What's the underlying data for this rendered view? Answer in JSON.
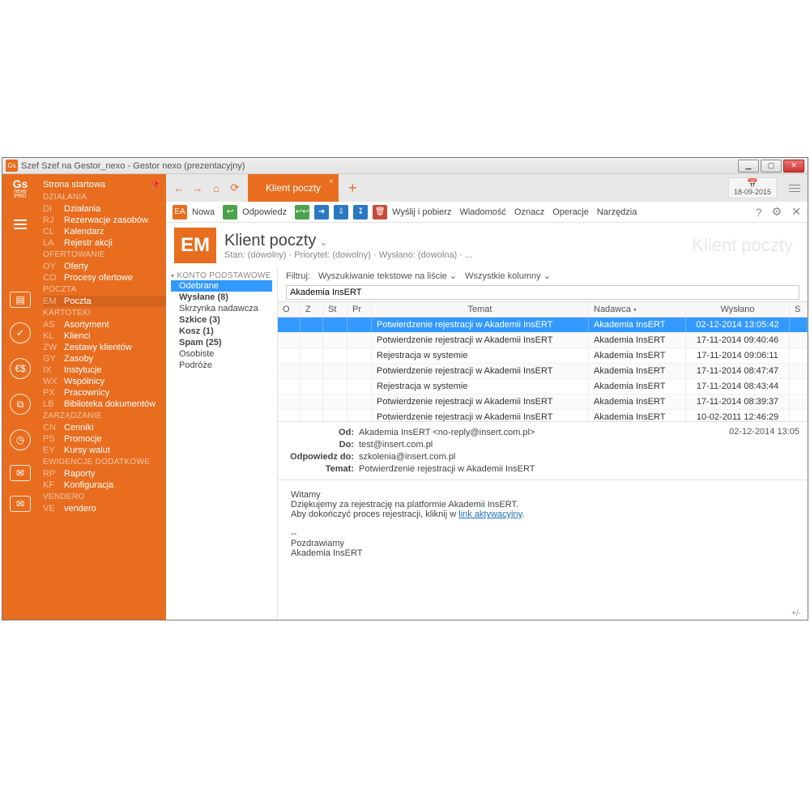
{
  "window": {
    "title": "Szef Szef na Gestor_nexo - Gestor nexo (prezentacyjny)",
    "app_badge": "Gs"
  },
  "date_widget": "18-09-2015",
  "rail_logo": {
    "top": "Gs",
    "mid": "nexo",
    "bot": "PRO"
  },
  "nav": {
    "home": "Strona startowa",
    "groups": [
      {
        "header": "DZIAŁANIA",
        "items": [
          {
            "code": "DI",
            "label": "Działania"
          },
          {
            "code": "RJ",
            "label": "Rezerwacje zasobów"
          },
          {
            "code": "CL",
            "label": "Kalendarz"
          },
          {
            "code": "LA",
            "label": "Rejestr akcji"
          }
        ]
      },
      {
        "header": "OFERTOWANIE",
        "items": [
          {
            "code": "OY",
            "label": "Oferty"
          },
          {
            "code": "CO",
            "label": "Procesy ofertowe"
          }
        ]
      },
      {
        "header": "POCZTA",
        "items": [
          {
            "code": "EM",
            "label": "Poczta",
            "active": true
          }
        ]
      },
      {
        "header": "KARTOTEKI",
        "items": [
          {
            "code": "AS",
            "label": "Asortyment"
          },
          {
            "code": "KL",
            "label": "Klienci"
          },
          {
            "code": "ZW",
            "label": "Zestawy klientów"
          },
          {
            "code": "GY",
            "label": "Zasoby"
          },
          {
            "code": "IX",
            "label": "Instytucje"
          },
          {
            "code": "WX",
            "label": "Wspólnicy"
          },
          {
            "code": "PX",
            "label": "Pracownicy"
          },
          {
            "code": "LB",
            "label": "Biblioteka dokumentów"
          }
        ]
      },
      {
        "header": "ZARZĄDZANIE",
        "items": [
          {
            "code": "CN",
            "label": "Cenniki"
          },
          {
            "code": "PS",
            "label": "Promocje"
          },
          {
            "code": "EY",
            "label": "Kursy walut"
          }
        ]
      },
      {
        "header": "EWIDENCJE DODATKOWE",
        "items": [
          {
            "code": "RP",
            "label": "Raporty"
          },
          {
            "code": "KF",
            "label": "Konfiguracja"
          }
        ]
      },
      {
        "header": "VENDERO",
        "items": [
          {
            "code": "VE",
            "label": "vendero"
          }
        ]
      }
    ]
  },
  "tab": {
    "label": "Klient poczty"
  },
  "toolbar": {
    "new": "Nowa",
    "reply": "Odpowiedz",
    "sendrecv": "Wyślij i pobierz",
    "message": "Wiadomość",
    "mark": "Oznacz",
    "ops": "Operacje",
    "tools": "Narzędzia"
  },
  "page": {
    "badge": "EM",
    "title": "Klient poczty",
    "subtitle": "Stan: (dowolny) · Priorytet: (dowolny) · Wysłano: (dowolna) · ...",
    "ghost": "Klient poczty"
  },
  "folders": {
    "account": "KONTO PODSTAWOWE",
    "items": [
      {
        "label": "Odebrane",
        "sel": true,
        "bold": false
      },
      {
        "label": "Wysłane (8)",
        "bold": true
      },
      {
        "label": "Skrzynka nadawcza"
      },
      {
        "label": "Szkice (3)",
        "bold": true
      },
      {
        "label": "Kosz (1)",
        "bold": true
      },
      {
        "label": "Spam (25)",
        "bold": true
      },
      {
        "label": "Osobiste"
      },
      {
        "label": "Podróże"
      }
    ]
  },
  "filter": {
    "label": "Filtruj:",
    "search_mode": "Wyszukiwanie tekstowe na liście",
    "columns": "Wszystkie kolumny",
    "search_value": "Akademia InsERT"
  },
  "grid": {
    "headers": {
      "o": "O",
      "z": "Z",
      "st": "St",
      "pr": "Pr",
      "subject": "Temat",
      "sender": "Nadawca",
      "sent": "Wysłano",
      "s": "S"
    },
    "rows": [
      {
        "subject": "Potwierdzenie rejestracji w Akademii InsERT",
        "sender": "Akademia InsERT",
        "sent": "02-12-2014 13:05:42",
        "sel": true
      },
      {
        "subject": "Potwierdzenie rejestracji w Akademii InsERT",
        "sender": "Akademia InsERT",
        "sent": "17-11-2014 09:40:46"
      },
      {
        "subject": "Rejestracja w systemie",
        "sender": "Akademia InsERT",
        "sent": "17-11-2014 09:06:11"
      },
      {
        "subject": "Potwierdzenie rejestracji w Akademii InsERT",
        "sender": "Akademia InsERT",
        "sent": "17-11-2014 08:47:47"
      },
      {
        "subject": "Rejestracja w systemie",
        "sender": "Akademia InsERT",
        "sent": "17-11-2014 08:43:44"
      },
      {
        "subject": "Potwierdzenie rejestracji w Akademii InsERT",
        "sender": "Akademia InsERT",
        "sent": "17-11-2014 08:39:37"
      },
      {
        "subject": "Potwierdzenie rejestracji w Akademii InsERT",
        "sender": "Akademia InsERT",
        "sent": "10-02-2011 12:46:29"
      }
    ]
  },
  "preview": {
    "labels": {
      "from": "Od:",
      "to": "Do:",
      "replyto": "Odpowiedz do:",
      "subject": "Temat:"
    },
    "from": "Akademia InsERT <no-reply@insert.com.pl>",
    "to": "test@insert.com.pl",
    "replyto": "szkolenia@insert.com.pl",
    "subject": "Potwierdzenie rejestracji w Akademii InsERT",
    "date": "02-12-2014 13:05",
    "body": {
      "greeting": "Witamy",
      "line1": "Dziękujemy za rejestrację na platformie Akademii InsERT.",
      "line2_prefix": "Aby dokończyć proces rejestracji, kliknij w ",
      "link": "link aktywacyjny",
      "sig1": "--",
      "sig2": "Pozdrawiamy",
      "sig3": "Akademia InsERT"
    }
  },
  "footer_toggle": "+/-"
}
